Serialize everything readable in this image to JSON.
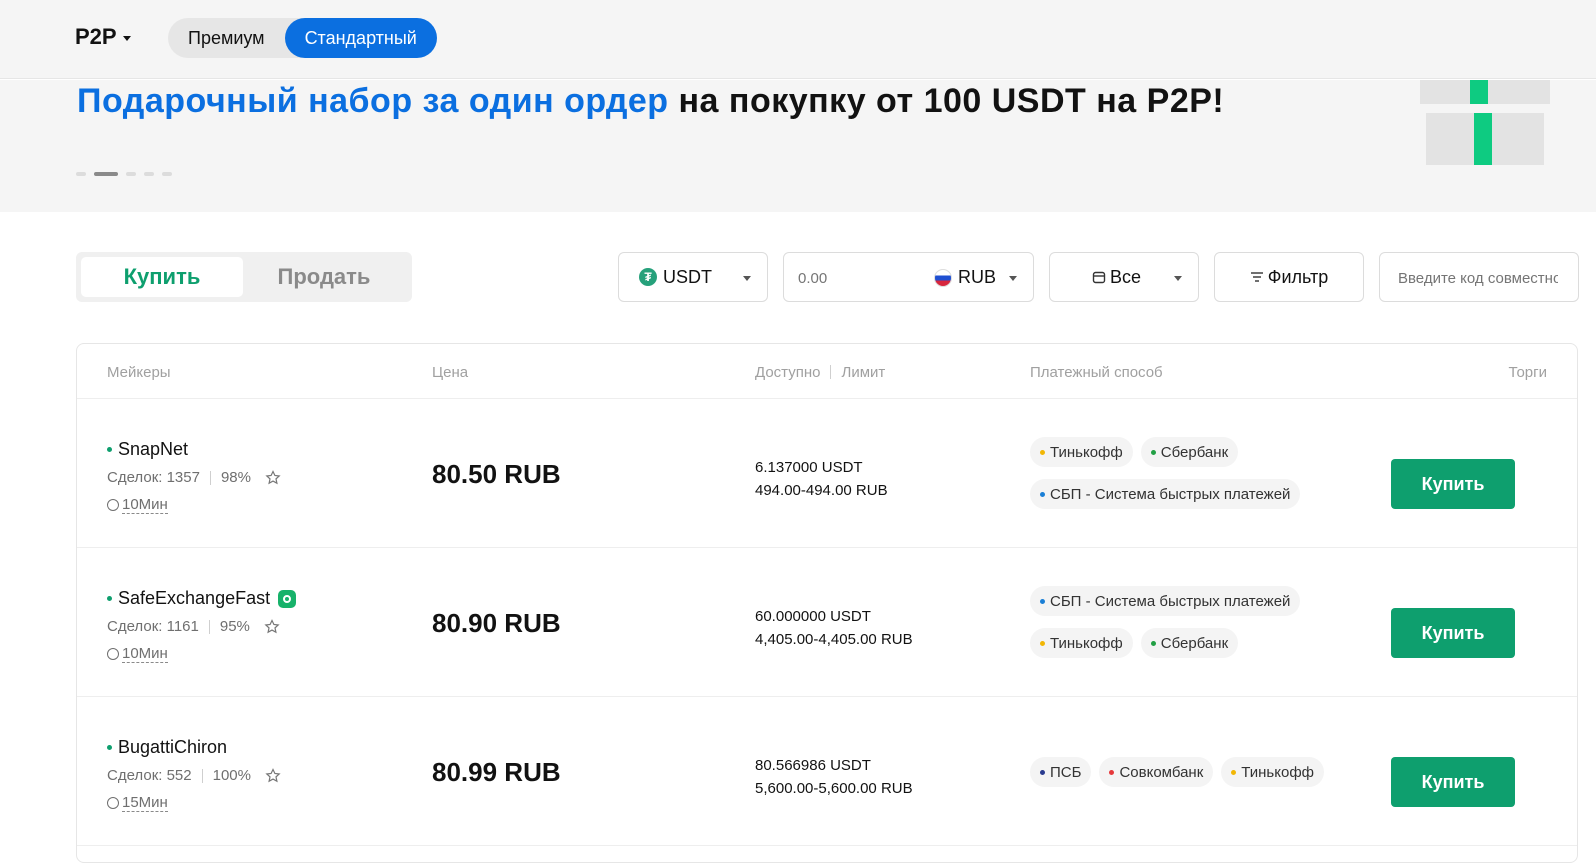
{
  "header": {
    "brand": "P2P",
    "segments": [
      {
        "label": "Премиум",
        "active": false
      },
      {
        "label": "Стандартный",
        "active": true
      }
    ]
  },
  "banner": {
    "title_highlight": "Подарочный набор за один ордер",
    "title_rest": " на покупку от 100 USDT на P2P!",
    "slide_count": 5,
    "active_slide": 2
  },
  "trade": {
    "buy_label": "Купить",
    "sell_label": "Продать"
  },
  "filters": {
    "coin": "USDT",
    "amount_placeholder": "0.00",
    "fiat": "RUB",
    "payment": "Все",
    "filter_label": "Фильтр",
    "code_placeholder": "Введите код совместно"
  },
  "table": {
    "headers": {
      "makers": "Мейкеры",
      "price": "Цена",
      "available": "Доступно",
      "limit": "Лимит",
      "payment": "Платежный способ",
      "trade": "Торги"
    },
    "rows": [
      {
        "name": "SnapNet",
        "verified": false,
        "deals": "Сделок: 1357",
        "rate": "98%",
        "time": "10Мин",
        "price": "80.50 RUB",
        "available": "6.137000 USDT",
        "limit": "494.00-494.00 RUB",
        "methods": [
          {
            "label": "Тинькофф",
            "color": "#f2b705"
          },
          {
            "label": "Сбербанк",
            "color": "#22a045"
          },
          {
            "label": "СБП - Система быстрых платежей",
            "color": "#1a7fd6"
          }
        ],
        "action": "Купить"
      },
      {
        "name": "SafeExchangeFast",
        "verified": true,
        "deals": "Сделок: 1161",
        "rate": "95%",
        "time": "10Мин",
        "price": "80.90 RUB",
        "available": "60.000000 USDT",
        "limit": "4,405.00-4,405.00 RUB",
        "methods": [
          {
            "label": "СБП - Система быстрых платежей",
            "color": "#1a7fd6"
          },
          {
            "label": "Тинькофф",
            "color": "#f2b705"
          },
          {
            "label": "Сбербанк",
            "color": "#22a045"
          }
        ],
        "action": "Купить"
      },
      {
        "name": "BugattiChiron",
        "verified": false,
        "deals": "Сделок: 552",
        "rate": "100%",
        "time": "15Мин",
        "price": "80.99 RUB",
        "available": "80.566986 USDT",
        "limit": "5,600.00-5,600.00 RUB",
        "methods": [
          {
            "label": "ПСБ",
            "color": "#2a3b8f"
          },
          {
            "label": "Совкомбанк",
            "color": "#e5383b"
          },
          {
            "label": "Тинькофф",
            "color": "#f2b705"
          }
        ],
        "action": "Купить"
      }
    ]
  }
}
